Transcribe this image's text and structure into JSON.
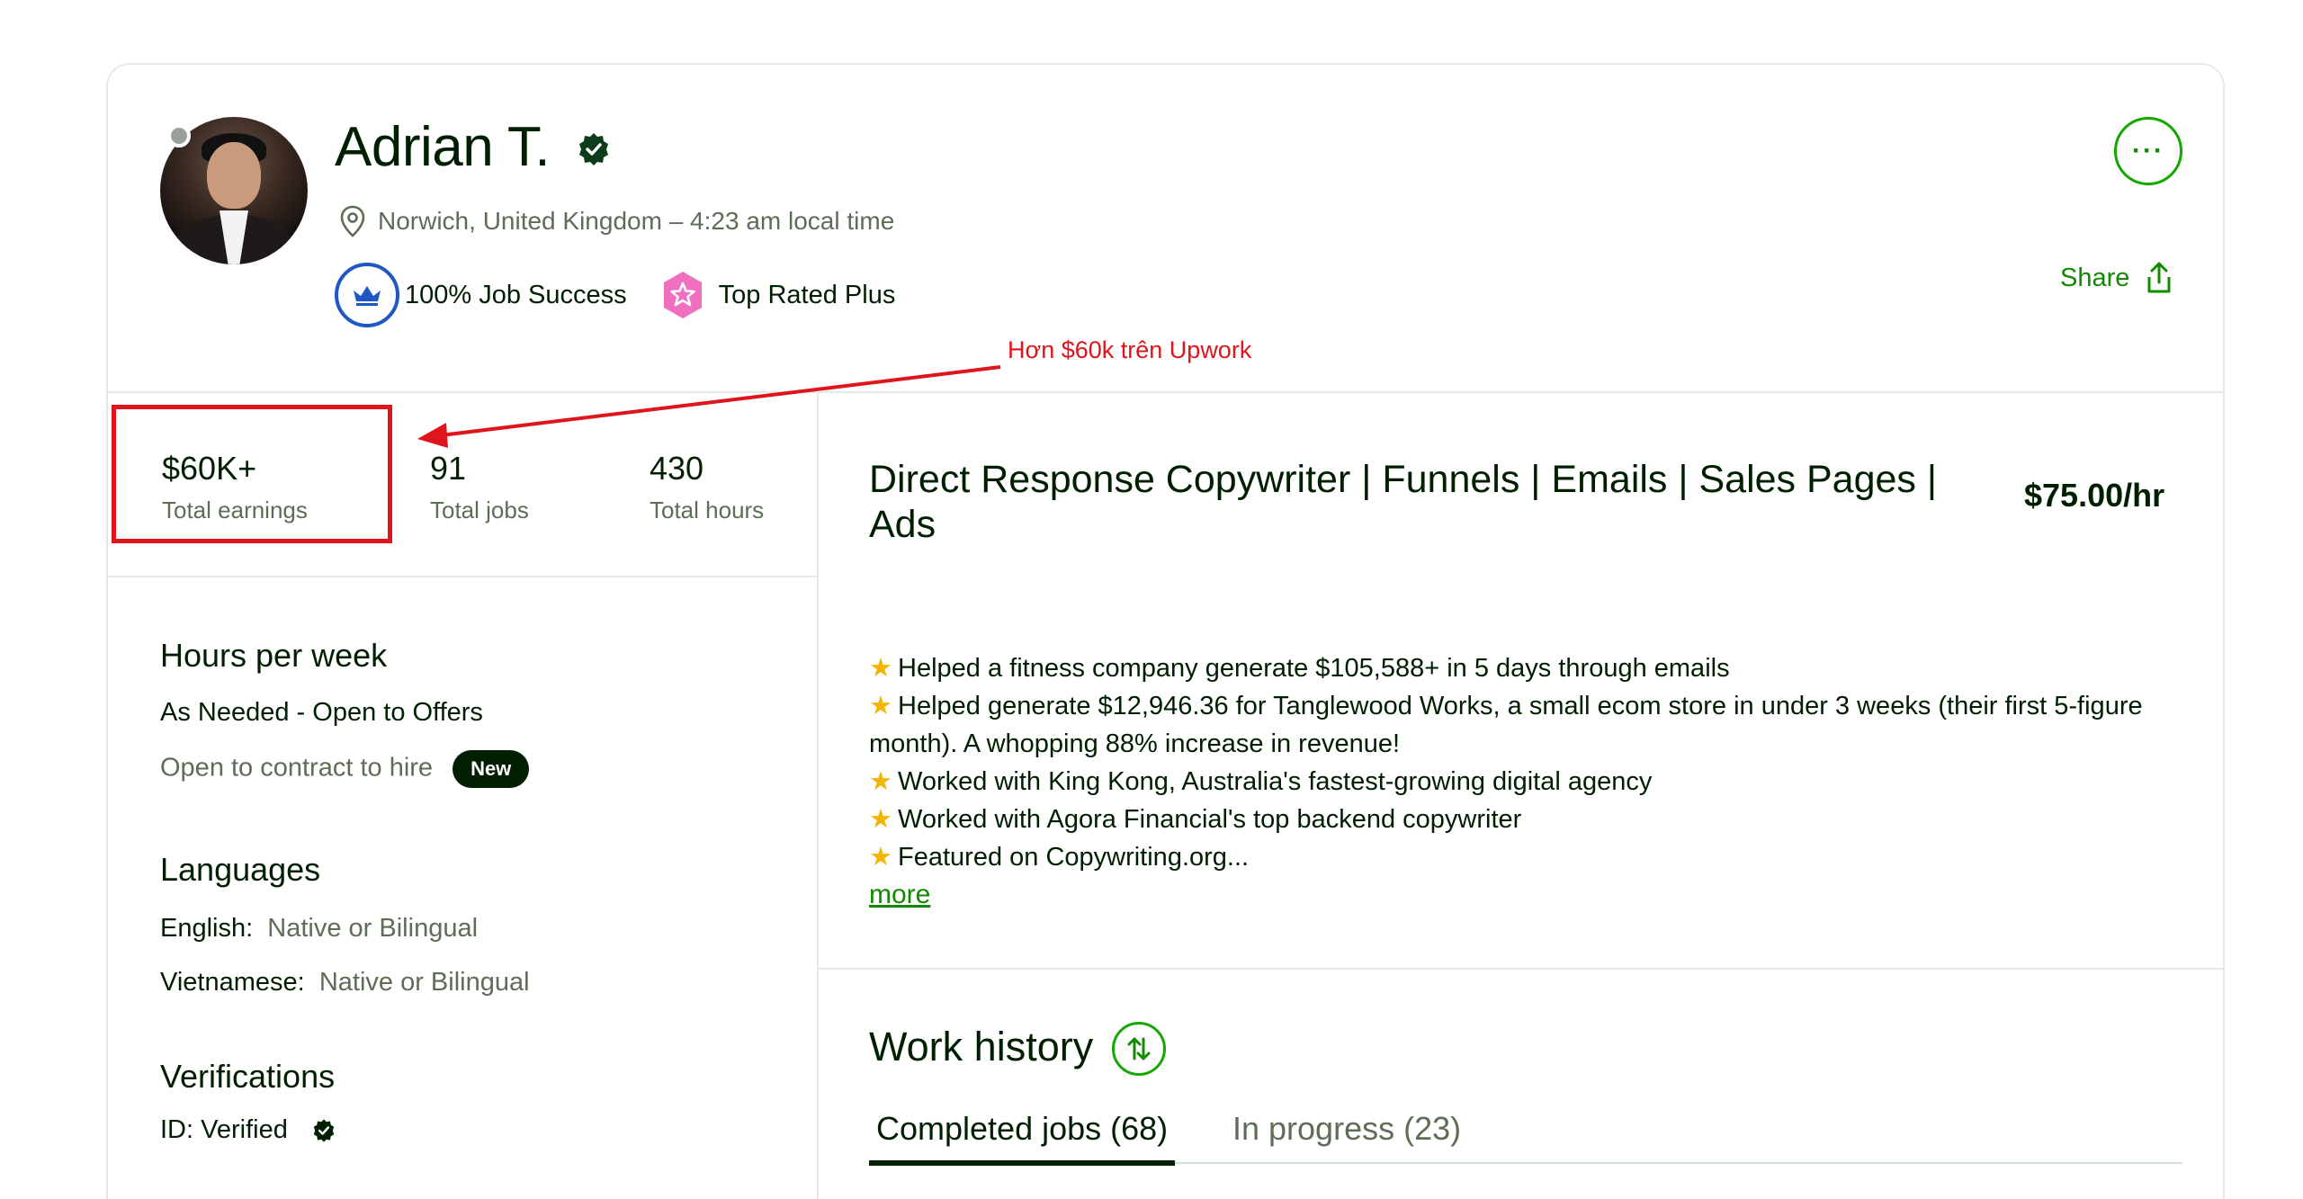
{
  "profile": {
    "name": "Adrian T.",
    "location": "Norwich, United Kingdom – 4:23 am local time",
    "job_success": "100% Job Success",
    "top_rated": "Top Rated Plus",
    "share_label": "Share",
    "more_label": "···"
  },
  "annotation": {
    "text": "Hơn $60k trên Upwork",
    "color": "#e0141b"
  },
  "stats": [
    {
      "value": "$60K+",
      "label": "Total earnings"
    },
    {
      "value": "91",
      "label": "Total jobs"
    },
    {
      "value": "430",
      "label": "Total hours"
    }
  ],
  "sidebar": {
    "hours": {
      "title": "Hours per week",
      "value": "As Needed - Open to Offers",
      "contract": "Open to contract to hire",
      "new_badge": "New"
    },
    "languages": {
      "title": "Languages",
      "items": [
        {
          "lang": "English:",
          "level": "Native or Bilingual"
        },
        {
          "lang": "Vietnamese:",
          "level": "Native or Bilingual"
        }
      ]
    },
    "verifications": {
      "title": "Verifications",
      "id": "ID: Verified"
    }
  },
  "main": {
    "title": "Direct Response Copywriter | Funnels | Emails | Sales Pages | Ads",
    "rate": "$75.00/hr",
    "overview": [
      "Helped a fitness company generate $105,588+ in 5 days through emails",
      "Helped generate $12,946.36 for Tanglewood Works, a small ecom store in under 3 weeks (their first 5-figure month). A whopping 88% increase in revenue!",
      "Worked with King Kong, Australia's fastest-growing digital agency",
      "Worked with Agora Financial's top backend copywriter",
      "Featured on Copywriting.org..."
    ],
    "more_link": "more",
    "work_history": {
      "title": "Work history",
      "tabs": [
        {
          "label": "Completed jobs (68)"
        },
        {
          "label": "In progress (23)"
        }
      ]
    }
  },
  "colors": {
    "brand_green": "#108a00",
    "text_dark": "#001e00",
    "text_muted": "#5e6d55",
    "jss_blue": "#1f57c3",
    "trp_pink": "#f06fbf"
  }
}
